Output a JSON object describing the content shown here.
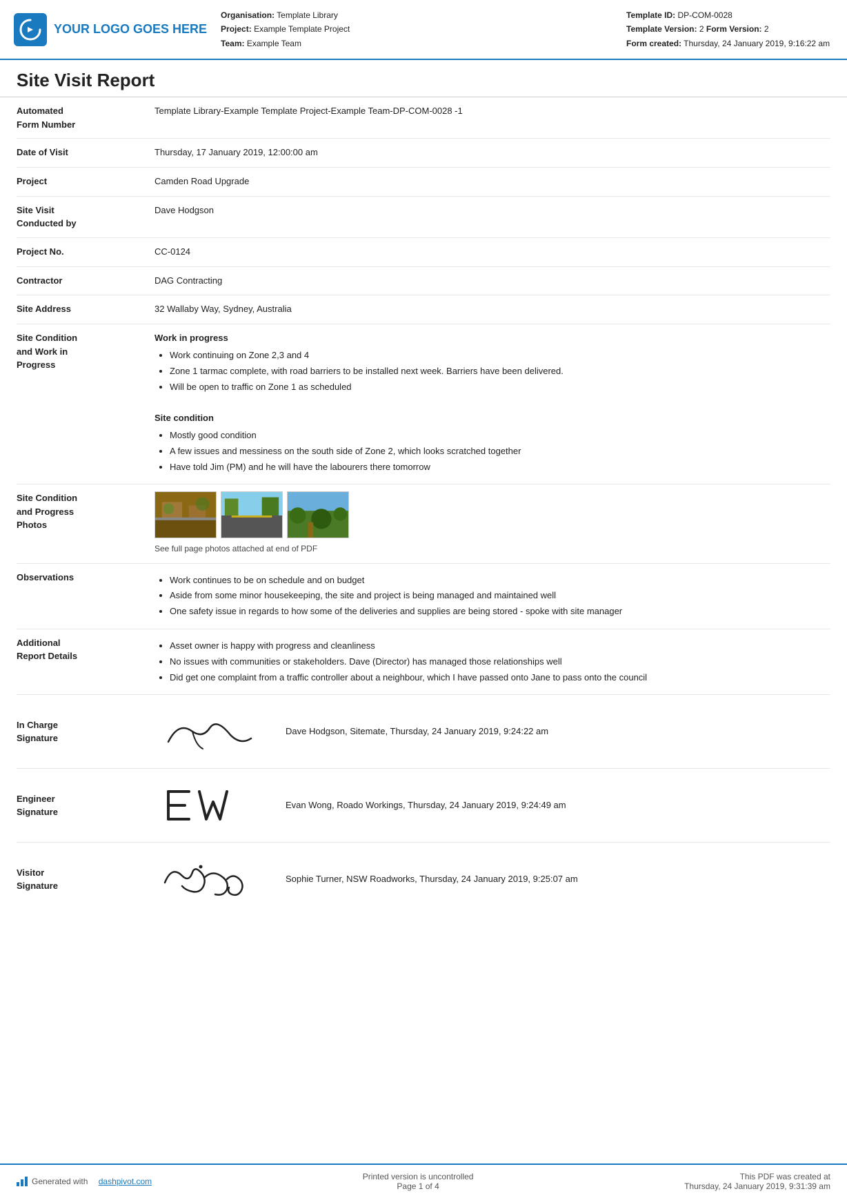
{
  "header": {
    "logo_text": "YOUR LOGO GOES HERE",
    "org_label": "Organisation:",
    "org_value": "Template Library",
    "project_label": "Project:",
    "project_value": "Example Template Project",
    "team_label": "Team:",
    "team_value": "Example Team",
    "template_id_label": "Template ID:",
    "template_id_value": "DP-COM-0028",
    "template_version_label": "Template Version:",
    "template_version_value": "2",
    "form_version_label": "Form Version:",
    "form_version_value": "2",
    "form_created_label": "Form created:",
    "form_created_value": "Thursday, 24 January 2019, 9:16:22 am"
  },
  "report": {
    "title": "Site Visit Report",
    "fields": [
      {
        "label": "Automated\nForm Number",
        "value_text": "Template Library-Example Template Project-Example Team-DP-COM-0028   -1",
        "type": "text"
      },
      {
        "label": "Date of Visit",
        "value_text": "Thursday, 17 January 2019, 12:00:00 am",
        "type": "text"
      },
      {
        "label": "Project",
        "value_text": "Camden Road Upgrade",
        "type": "text"
      },
      {
        "label": "Site Visit\nConducted by",
        "value_text": "Dave Hodgson",
        "type": "text"
      },
      {
        "label": "Project No.",
        "value_text": "CC-0124",
        "type": "text"
      },
      {
        "label": "Contractor",
        "value_text": "DAG Contracting",
        "type": "text"
      },
      {
        "label": "Site Address",
        "value_text": "32 Wallaby Way, Sydney, Australia",
        "type": "text"
      },
      {
        "label": "Site Condition\nand Work in\nProgress",
        "type": "complex",
        "sections": [
          {
            "heading": "Work in progress",
            "items": [
              "Work continuing on Zone 2,3 and 4",
              "Zone 1 tarmac complete, with road barriers to be installed next week. Barriers have been delivered.",
              "Will be open to traffic on Zone 1 as scheduled"
            ]
          },
          {
            "heading": "Site condition",
            "items": [
              "Mostly good condition",
              "A few issues and messiness on the south side of Zone 2, which looks scratched together",
              "Have told Jim (PM) and he will have the labourers there tomorrow"
            ]
          }
        ]
      },
      {
        "label": "Site Condition\nand Progress\nPhotos",
        "type": "photos",
        "caption": "See full page photos attached at end of PDF"
      },
      {
        "label": "Observations",
        "type": "list",
        "items": [
          "Work continues to be on schedule and on budget",
          "Aside from some minor housekeeping, the site and project is being managed and maintained well",
          "One safety issue in regards to how some of the deliveries and supplies are being stored - spoke with site manager"
        ]
      },
      {
        "label": "Additional\nReport Details",
        "type": "list",
        "items": [
          "Asset owner is happy with progress and cleanliness",
          "No issues with communities or stakeholders. Dave (Director) has managed those relationships well",
          "Did get one complaint from a traffic controller about a neighbour, which I have passed onto Jane to pass onto the council"
        ]
      }
    ],
    "signatures": [
      {
        "label": "In Charge\nSignature",
        "sig_type": "cursive",
        "sig_text": "Dave Hodgson, Sitemate, Thursday, 24 January 2019, 9:24:22 am"
      },
      {
        "label": "Engineer\nSignature",
        "sig_type": "initials",
        "sig_text": "Evan Wong, Roado Workings, Thursday, 24 January 2019, 9:24:49 am"
      },
      {
        "label": "Visitor\nSignature",
        "sig_type": "sophie",
        "sig_text": "Sophie Turner, NSW Roadworks, Thursday, 24 January 2019, 9:25:07 am"
      }
    ]
  },
  "footer": {
    "generated_text": "Generated with",
    "generated_link": "dashpivot.com",
    "uncontrolled_text": "Printed version is uncontrolled\nPage 1 of 4",
    "created_text": "This PDF was created at\nThursday, 24 January 2019, 9:31:39 am"
  }
}
